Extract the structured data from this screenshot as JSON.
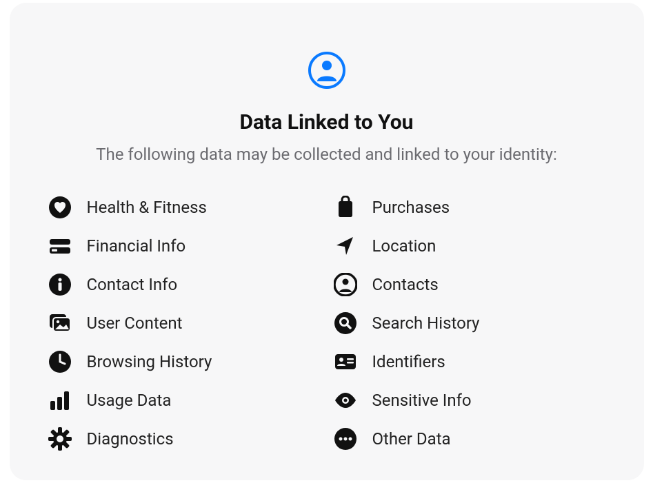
{
  "header": {
    "title": "Data Linked to You",
    "subtitle": "The following data may be collected and linked to your identity:"
  },
  "items": [
    {
      "icon": "heart-icon",
      "label": "Health & Fitness"
    },
    {
      "icon": "bag-icon",
      "label": "Purchases"
    },
    {
      "icon": "creditcard-icon",
      "label": "Financial Info"
    },
    {
      "icon": "location-arrow-icon",
      "label": "Location"
    },
    {
      "icon": "info-icon",
      "label": "Contact Info"
    },
    {
      "icon": "contacts-icon",
      "label": "Contacts"
    },
    {
      "icon": "photos-icon",
      "label": "User Content"
    },
    {
      "icon": "search-circle-icon",
      "label": "Search History"
    },
    {
      "icon": "clock-icon",
      "label": "Browsing History"
    },
    {
      "icon": "id-card-icon",
      "label": "Identifiers"
    },
    {
      "icon": "chart-bar-icon",
      "label": "Usage Data"
    },
    {
      "icon": "eye-icon",
      "label": "Sensitive Info"
    },
    {
      "icon": "gear-icon",
      "label": "Diagnostics"
    },
    {
      "icon": "ellipsis-circle-icon",
      "label": "Other Data"
    }
  ]
}
